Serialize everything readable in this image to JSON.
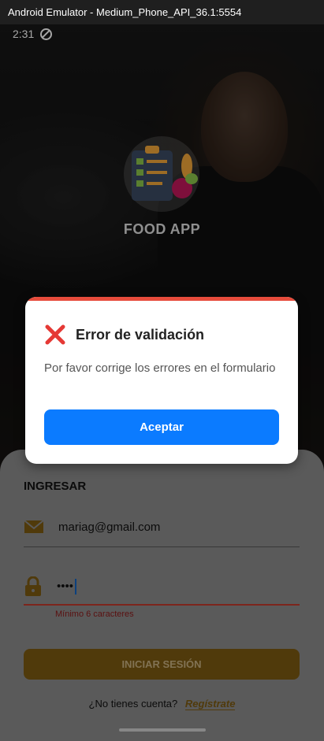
{
  "window": {
    "title": "Android Emulator - Medium_Phone_API_36.1:5554"
  },
  "statusbar": {
    "time": "2:31",
    "dnd_icon": "do-not-disturb-icon"
  },
  "app": {
    "name": "FOOD APP",
    "logo_icon": "clipboard-checklist-veggie-icon"
  },
  "login": {
    "section_title": "INGRESAR",
    "email_icon": "mail-icon",
    "email_value": "mariag@gmail.com",
    "password_icon": "lock-icon",
    "password_value": "••••",
    "password_error": "Mínimo 6 caracteres",
    "submit_label": "INICIAR SESIÓN",
    "register_prompt": "¿No tienes cuenta?",
    "register_link": "Regístrate"
  },
  "dialog": {
    "icon": "error-x-icon",
    "title": "Error de validación",
    "message": "Por favor corrige los errores en el formulario",
    "accept_label": "Aceptar",
    "accent_color": "#e74c3c",
    "button_color": "#0b7bff"
  }
}
